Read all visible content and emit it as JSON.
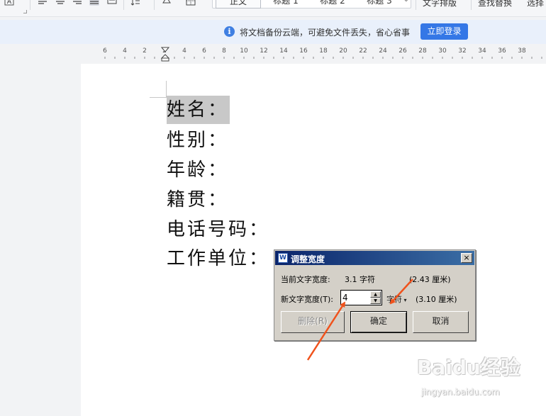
{
  "ribbon": {
    "styles": [
      "正文",
      "标题 1",
      "标题 2",
      "标题 3"
    ],
    "text_layout_label": "文字排版",
    "find_replace_label": "查找替换",
    "select_label": "选择"
  },
  "notification": {
    "message": "将文档备份云端，可避免文件丢失，省心省事",
    "login_button": "立即登录"
  },
  "ruler": {
    "labels": [
      "6",
      "4",
      "2",
      "2",
      "4",
      "6",
      "8",
      "10",
      "12",
      "14",
      "16",
      "18",
      "20",
      "22",
      "24",
      "26",
      "28",
      "30",
      "32",
      "34",
      "36",
      "38"
    ]
  },
  "document": {
    "lines": [
      "姓名：",
      "性别：",
      "年龄：",
      "籍贯：",
      "电话号码：",
      "工作单位："
    ],
    "selected_index": 0
  },
  "dialog": {
    "title": "调整宽度",
    "icon_letter": "W",
    "close_label": "×",
    "current_width_label": "当前文字宽度:",
    "current_width_value": "3.1 字符",
    "current_width_cm": "(2.43 厘米)",
    "new_width_label": "新文字宽度(T):",
    "new_width_value": "4",
    "unit_value": "字符",
    "new_width_cm": "(3.10 厘米)",
    "delete_button": "删除(R)",
    "ok_button": "确定",
    "cancel_button": "取消"
  },
  "colors": {
    "login_button": "#3477e6",
    "info_icon": "#3f7fe2",
    "annotation_arrow": "#f0521c",
    "selection": "#c8c8c8"
  },
  "watermark": {
    "brand": "Baidu经验",
    "url": "jingyan.baidu.com"
  }
}
